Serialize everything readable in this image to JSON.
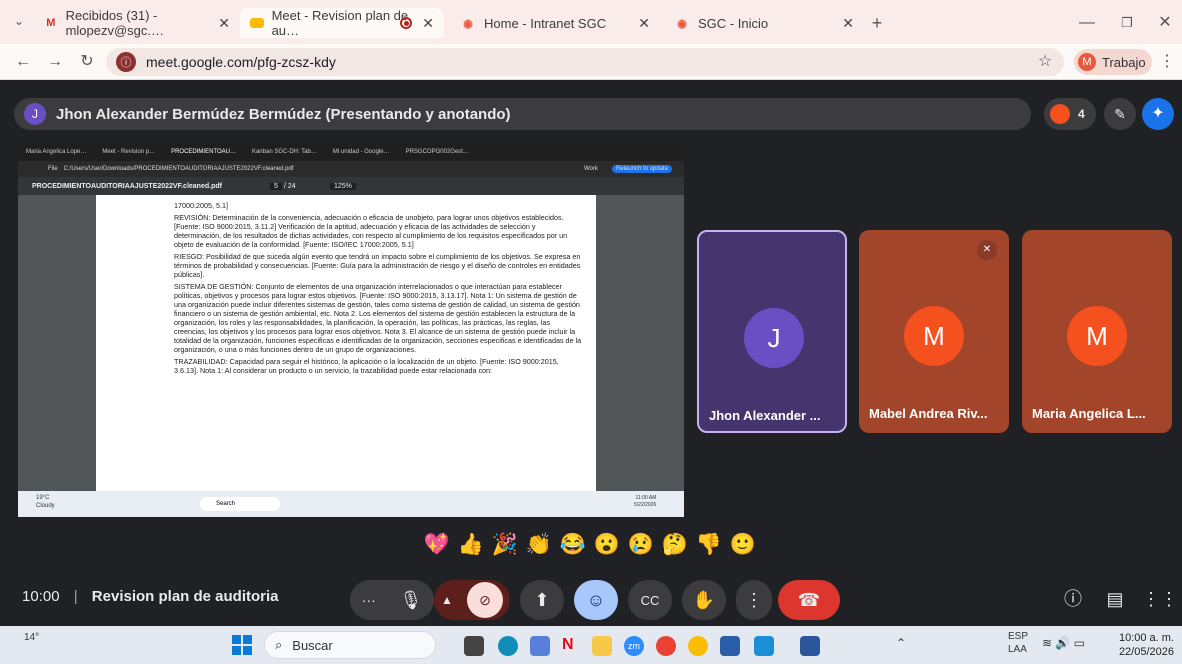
{
  "browser": {
    "tabs": [
      {
        "label": "Recibidos (31) - mlopezv@sgc.…",
        "icon": "gmail-icon"
      },
      {
        "label": "Meet - Revision plan de au…",
        "icon": "meet-icon",
        "active": true
      },
      {
        "label": "Home - Intranet SGC",
        "icon": "sgc-icon"
      },
      {
        "label": "SGC - Inicio",
        "icon": "sgc-icon"
      }
    ],
    "url": "meet.google.com/pfg-zcsz-kdy",
    "profile_label": "Trabajo",
    "profile_initial": "M"
  },
  "meet": {
    "presenter_initial": "J",
    "presenter_label": "Jhon Alexander Bermúdez Bermúdez (Presentando y anotando)",
    "participant_count": "4",
    "shared_screen": {
      "tabs": [
        "Maria Angelica Lope…",
        "Meet - Revision p…",
        "PROCEDIMIENTOAU…",
        "Kanban SGC-DH: Tab…",
        "Mi unidad - Google…",
        "PRSGCOPG002Gest…"
      ],
      "address": "C:/Users/User/Downloads/PROCEDIMIENTOAUDITORIAAJUSTE2022VF.cleaned.pdf",
      "file_label": "File",
      "work_label": "Work",
      "relaunch_label": "Relaunch to update",
      "pdf_name": "PROCEDIMIENTOAUDITORIAAJUSTE2022VF.cleaned.pdf",
      "page_current": "5",
      "page_total": "/ 24",
      "zoom": "125%",
      "doc_paragraphs": [
        "17000:2005, 5.1]",
        "REVISIÓN: Determinación de la conveniencia, adecuación o eficacia de unobjeto, para lograr unos objetivos establecidos. [Fuente: ISO 9000:2015, 3.11.2] Verificación de la aptitud, adecuación y eficacia de las actividades de selección y determinación, de los resultados de dichas actividades, con respecto al cumplimiento de los requisitos especificados por un objeto de evaluación de la conformidad. [Fuente: ISO/IEC 17000:2005, 5.1]",
        "RIESGO: Posibilidad de que suceda algún evento que tendrá un impacto sobre el cumplimiento de los objetivos. Se expresa en términos de probabilidad y consecuencias. [Fuente: Guía para la administración de riesgo y el diseño de controles en entidades públicas].",
        "SISTEMA DE GESTIÓN: Conjunto de elementos de una organización interrelacionados o que interactúan para establecer políticas, objetivos y procesos para lograr estos objetivos. [Fuente: ISO 9000:2015, 3.13.17]. Nota 1: Un sistema de gestión de una organización puede incluir diferentes sistemas de gestión, tales como sistema de gestión de calidad, un sistema de gestión financiero o un sistema de gestión ambiental, etc. Nota 2. Los elementos del sistema de gestión establecen la estructura de la organización, los roles y las responsabilidades, la planificación, la operación, las políticas, las prácticas, las reglas, las creencias, los objetivos y los procesos para lograr esos objetivos. Nota 3. El alcance de un sistema de gestión puede incluir la totalidad de la organización, funciones especificas e identificadas de la organización, secciones especificas e identificadas de la organización, o una o más funciones dentro de un grupo de organizaciones.",
        "TRAZABILIDAD: Capacidad para seguir el histórico, la aplicación o la localización de un objeto. [Fuente: ISO 9000:2015, 3.6.13]. Nota 1: Al considerar un producto o un servicio, la trazabilidad puede estar relacionada con:"
      ],
      "weather": "19°C",
      "weather_desc": "Cloudy",
      "search": "Search",
      "time": "11:00 AM",
      "date": "5/22/2026"
    },
    "tiles": [
      {
        "initial": "J",
        "name": "Jhon Alexander ...",
        "color": "#6a4ec4",
        "bg": "#44356f"
      },
      {
        "initial": "M",
        "name": "Mabel Andrea Riv...",
        "color": "#f4511e",
        "bg": "#a2452b"
      },
      {
        "initial": "M",
        "name": "Maria Angelica L...",
        "color": "#f4511e",
        "bg": "#a2452b"
      }
    ],
    "reactions": [
      "💖",
      "👍",
      "🎉",
      "👏",
      "😂",
      "😮",
      "😢",
      "🤔",
      "👎",
      "🙂"
    ],
    "time": "10:00",
    "separator": "|",
    "meeting_name": "Revision plan de auditoria"
  },
  "taskbar": {
    "temperature": "14°",
    "search_placeholder": "Buscar",
    "lang_line1": "ESP",
    "lang_line2": "LAA",
    "time": "10:00 a. m.",
    "date": "22/05/2026"
  }
}
